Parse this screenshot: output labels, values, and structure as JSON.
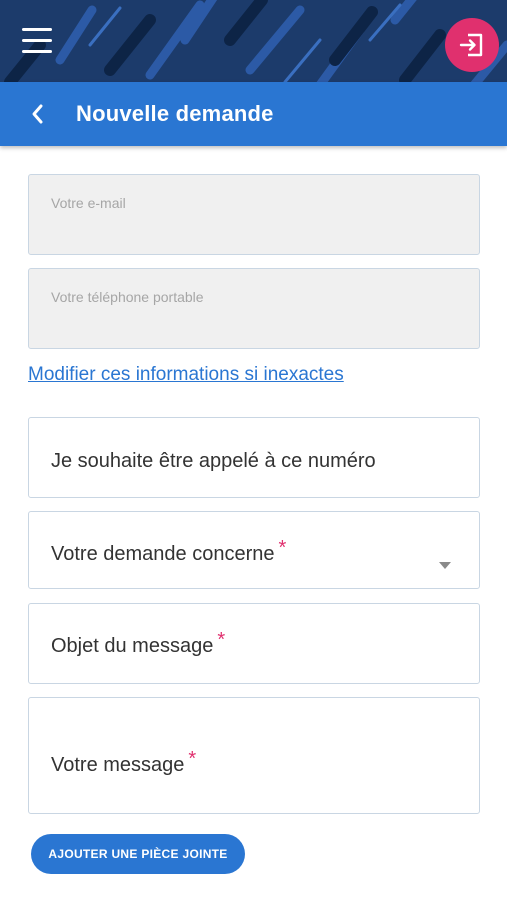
{
  "header": {
    "title": "Nouvelle demande",
    "back_icon": "chevron-left-icon"
  },
  "topbar": {
    "menu_icon": "hamburger-icon",
    "logout_icon": "sign-in-icon",
    "colors": {
      "background": "#1c3b6b",
      "logout": "#e0306e"
    }
  },
  "form": {
    "email_placeholder": "Votre e-mail",
    "phone_placeholder": "Votre téléphone portable",
    "modify_link": "Modifier ces informations si inexactes",
    "callback_label": "Je souhaite être appelé à ce numéro",
    "subject_select_label": "Votre demande concerne",
    "object_label": "Objet du message",
    "message_label": "Votre message",
    "required_marker": "*",
    "attach_button": "AJOUTER UNE PIÈCE JOINTE"
  },
  "colors": {
    "accent": "#2a76d2",
    "required": "#e0306e"
  }
}
